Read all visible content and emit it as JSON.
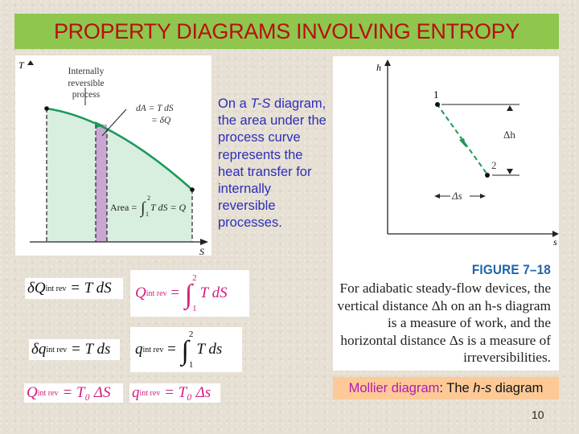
{
  "slide": {
    "title": "PROPERTY DIAGRAMS INVOLVING ENTROPY",
    "page_number": "10",
    "colors": {
      "title_bg": "#8ec64e",
      "title_text": "#b80f0f",
      "description_text": "#2b2fb8",
      "figure_label": "#1f64a8",
      "equation_pink": "#d0207c",
      "mollier_bg": "#fcc997",
      "mollier_term": "#b01cb3",
      "process_curve": "#1a9a5a",
      "area_fill": "#d8eedf",
      "strip_fill": "#c9a7d2"
    }
  },
  "ts_diagram": {
    "y_axis_label": "T",
    "x_axis_label": "S",
    "curve_label_line1": "Internally",
    "curve_label_line2": "reversible",
    "curve_label_line3": "process",
    "da_label_line1": "dA = T dS",
    "da_label_line2": "= δQ",
    "area_label_prefix": "Area =",
    "area_integral_upper": "2",
    "area_integral_lower": "1",
    "area_label_body": "T dS = Q"
  },
  "description": {
    "part1": "On a ",
    "italic": "T-S",
    "part2": " diagram, the area under the process curve represents the heat transfer for internally reversible processes."
  },
  "hs_diagram": {
    "y_axis_label": "h",
    "x_axis_label": "s",
    "point1_label": "1",
    "point2_label": "2",
    "delta_h_label": "Δh",
    "delta_s_label": "Δs",
    "figure_label": "FIGURE 7–18",
    "caption": "For adiabatic steady-flow devices, the vertical distance Δh on an h-s diagram is a measure of work, and the horizontal distance Δs is a measure of irreversibilities."
  },
  "equations": {
    "eq1": {
      "lhs_sym": "δQ",
      "lhs_sub": "int rev",
      "rhs": "= T dS"
    },
    "eq2": {
      "lhs_sym": "Q",
      "lhs_sub": "int rev",
      "eq": "=",
      "upper": "2",
      "lower": "1",
      "rhs": "T dS"
    },
    "eq3": {
      "lhs_sym": "δq",
      "lhs_sub": "int rev",
      "rhs": "= T ds"
    },
    "eq4": {
      "lhs_sym": "q",
      "lhs_sub": "int rev",
      "eq": "=",
      "upper": "2",
      "lower": "1",
      "rhs": "T ds"
    },
    "eq5": {
      "lhs_sym": "Q",
      "lhs_sub": "int rev",
      "rhs": "= T₀ ΔS"
    },
    "eq6": {
      "lhs_sym": "q",
      "lhs_sub": "int rev",
      "rhs": "= T₀ Δs"
    }
  },
  "mollier": {
    "term": "Mollier diagram",
    "sep": ":",
    "rest1": " The ",
    "italic": "h-s",
    "rest2": " diagram"
  }
}
